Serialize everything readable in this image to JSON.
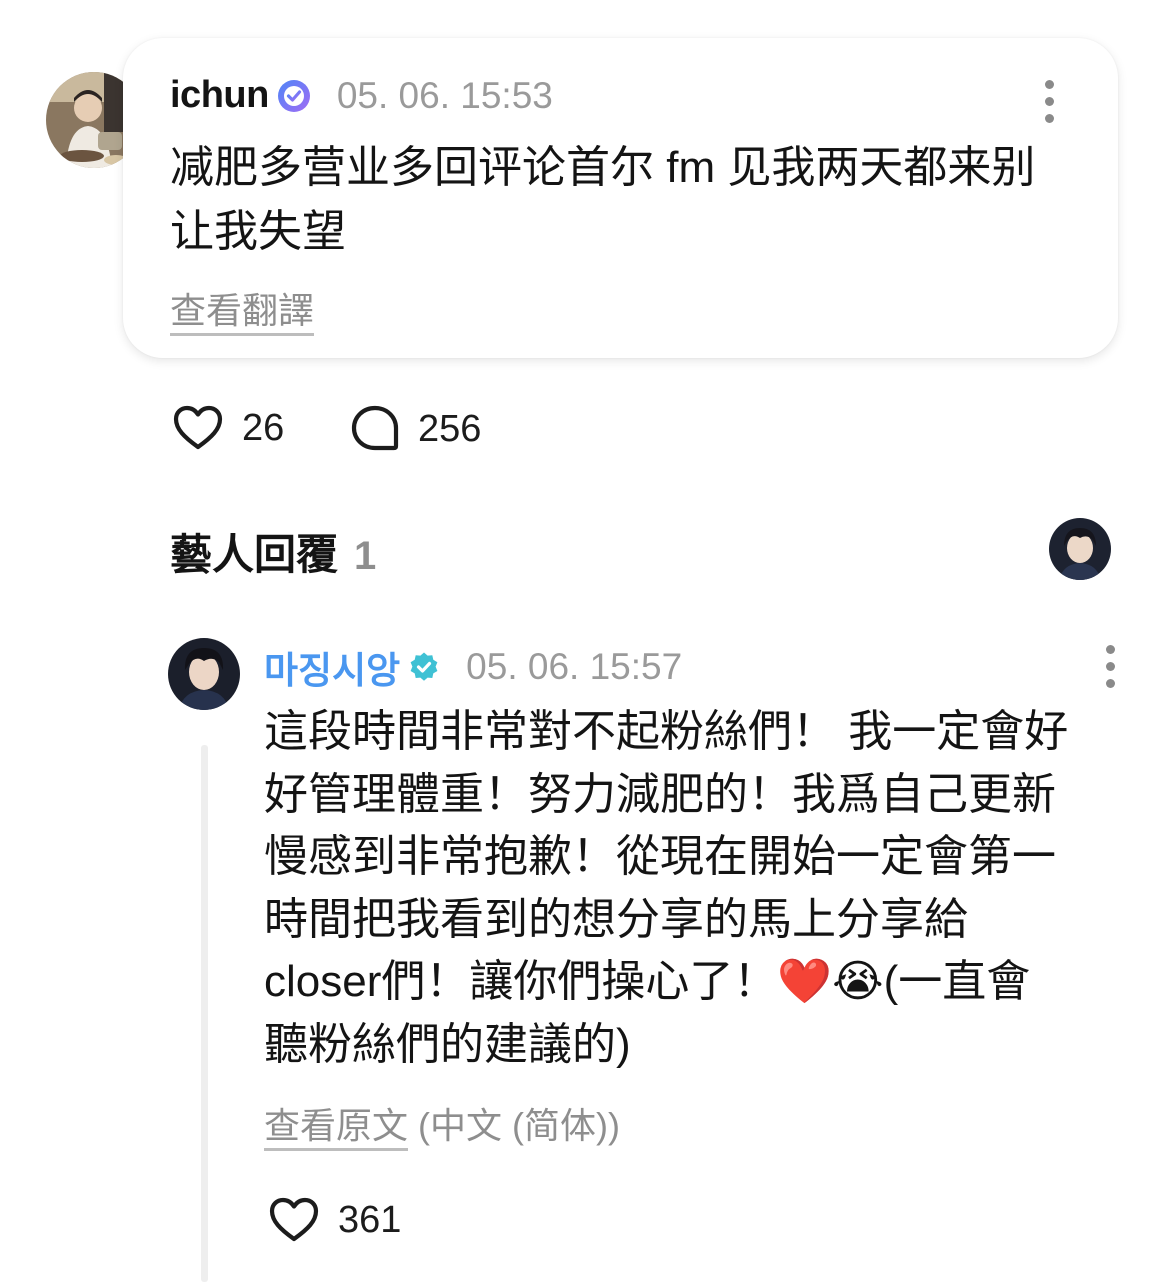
{
  "comment": {
    "username": "ichun",
    "timestamp": "05. 06. 15:53",
    "text_lines": [
      "减肥多营业多回评论首尔 fm 见我两天都来别",
      "让我失望"
    ],
    "translate_link": "查看翻譯",
    "likes": "26",
    "replies": "256"
  },
  "artist_section": {
    "title": "藝人回覆",
    "count": "1"
  },
  "reply": {
    "username": "마징시앙",
    "timestamp": "05. 06. 15:57",
    "text_lines": [
      "這段時間非常對不起粉絲們！ 我一定會好",
      "好管理體重！努力減肥的！我爲自己更新",
      "慢感到非常抱歉！從現在開始一定會第一",
      "時間把我看到的想分享的馬上分享給",
      "closer們！讓你們操心了！❤️😭(一直會",
      "聽粉絲們的建議的)"
    ],
    "original_link": "查看原文",
    "original_lang": " (中文 (简体))",
    "likes": "361"
  },
  "colors": {
    "accent_blue": "#4a97f0",
    "verified_purple": "#8b7cf6",
    "verified_teal": "#3fc1d4",
    "muted_gray": "#8e8e8e"
  },
  "icons": [
    "verified-badge-icon",
    "kebab-menu-icon",
    "heart-icon",
    "comment-bubble-icon"
  ]
}
